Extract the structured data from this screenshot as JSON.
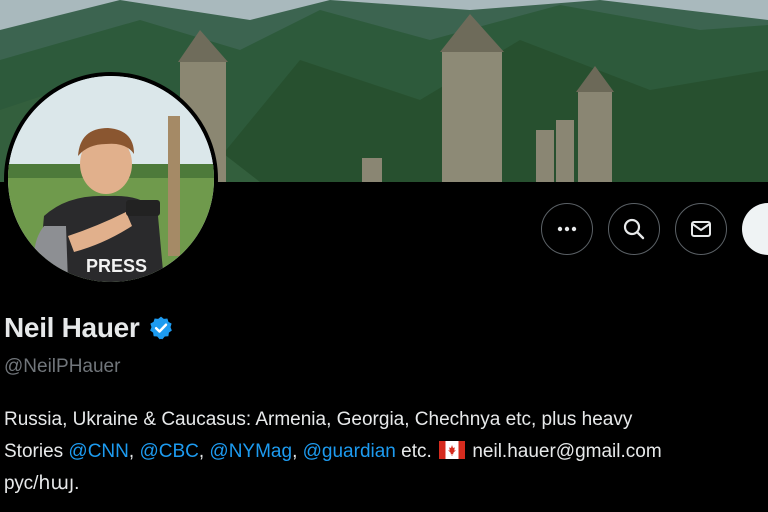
{
  "profile": {
    "display_name": "Neil Hauer",
    "verified": true,
    "handle": "@NeilPHauer",
    "avatar_badge_text": "PRESS",
    "bio": {
      "line1": "Russia, Ukraine & Caucasus: Armenia, Georgia, Chechnya etc, plus heavy",
      "line2_prefix": "Stories ",
      "mentions": [
        "@CNN",
        "@CBC",
        "@NYMag",
        "@guardian"
      ],
      "separator": ", ",
      "line2_after_mentions": " etc. ",
      "flag_icon": "canada-flag-icon",
      "email": "neil.hauer@gmail.com",
      "line3": "рус/հայ."
    }
  },
  "actions": {
    "more_icon": "more-horizontal-icon",
    "search_icon": "search-icon",
    "message_icon": "envelope-icon"
  },
  "colors": {
    "background": "#000000",
    "accent_blue": "#1d9bf0",
    "secondary_text": "#71767b",
    "primary_text": "#e7e9ea"
  }
}
